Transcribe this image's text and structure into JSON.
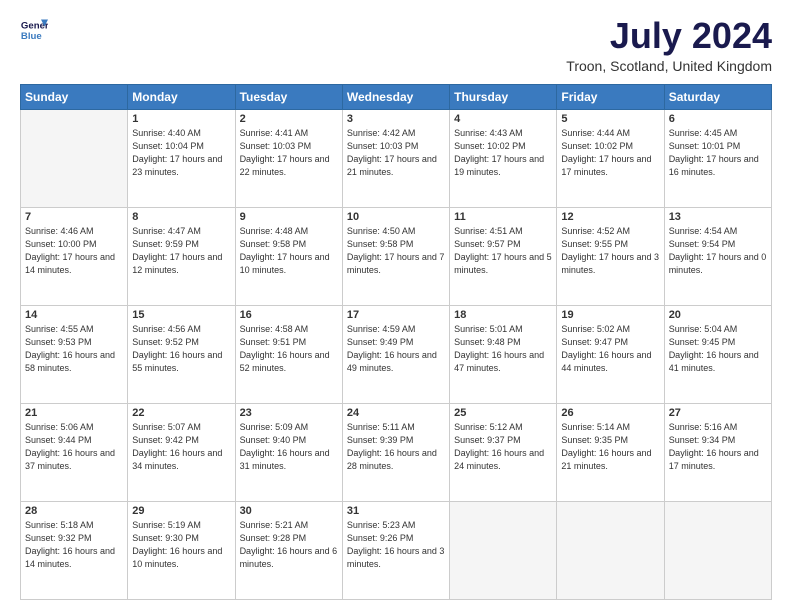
{
  "header": {
    "logo_line1": "General",
    "logo_line2": "Blue",
    "main_title": "July 2024",
    "subtitle": "Troon, Scotland, United Kingdom"
  },
  "columns": [
    "Sunday",
    "Monday",
    "Tuesday",
    "Wednesday",
    "Thursday",
    "Friday",
    "Saturday"
  ],
  "weeks": [
    [
      {
        "day": "",
        "text": ""
      },
      {
        "day": "1",
        "text": "Sunrise: 4:40 AM\nSunset: 10:04 PM\nDaylight: 17 hours\nand 23 minutes."
      },
      {
        "day": "2",
        "text": "Sunrise: 4:41 AM\nSunset: 10:03 PM\nDaylight: 17 hours\nand 22 minutes."
      },
      {
        "day": "3",
        "text": "Sunrise: 4:42 AM\nSunset: 10:03 PM\nDaylight: 17 hours\nand 21 minutes."
      },
      {
        "day": "4",
        "text": "Sunrise: 4:43 AM\nSunset: 10:02 PM\nDaylight: 17 hours\nand 19 minutes."
      },
      {
        "day": "5",
        "text": "Sunrise: 4:44 AM\nSunset: 10:02 PM\nDaylight: 17 hours\nand 17 minutes."
      },
      {
        "day": "6",
        "text": "Sunrise: 4:45 AM\nSunset: 10:01 PM\nDaylight: 17 hours\nand 16 minutes."
      }
    ],
    [
      {
        "day": "7",
        "text": "Sunrise: 4:46 AM\nSunset: 10:00 PM\nDaylight: 17 hours\nand 14 minutes."
      },
      {
        "day": "8",
        "text": "Sunrise: 4:47 AM\nSunset: 9:59 PM\nDaylight: 17 hours\nand 12 minutes."
      },
      {
        "day": "9",
        "text": "Sunrise: 4:48 AM\nSunset: 9:58 PM\nDaylight: 17 hours\nand 10 minutes."
      },
      {
        "day": "10",
        "text": "Sunrise: 4:50 AM\nSunset: 9:58 PM\nDaylight: 17 hours\nand 7 minutes."
      },
      {
        "day": "11",
        "text": "Sunrise: 4:51 AM\nSunset: 9:57 PM\nDaylight: 17 hours\nand 5 minutes."
      },
      {
        "day": "12",
        "text": "Sunrise: 4:52 AM\nSunset: 9:55 PM\nDaylight: 17 hours\nand 3 minutes."
      },
      {
        "day": "13",
        "text": "Sunrise: 4:54 AM\nSunset: 9:54 PM\nDaylight: 17 hours\nand 0 minutes."
      }
    ],
    [
      {
        "day": "14",
        "text": "Sunrise: 4:55 AM\nSunset: 9:53 PM\nDaylight: 16 hours\nand 58 minutes."
      },
      {
        "day": "15",
        "text": "Sunrise: 4:56 AM\nSunset: 9:52 PM\nDaylight: 16 hours\nand 55 minutes."
      },
      {
        "day": "16",
        "text": "Sunrise: 4:58 AM\nSunset: 9:51 PM\nDaylight: 16 hours\nand 52 minutes."
      },
      {
        "day": "17",
        "text": "Sunrise: 4:59 AM\nSunset: 9:49 PM\nDaylight: 16 hours\nand 49 minutes."
      },
      {
        "day": "18",
        "text": "Sunrise: 5:01 AM\nSunset: 9:48 PM\nDaylight: 16 hours\nand 47 minutes."
      },
      {
        "day": "19",
        "text": "Sunrise: 5:02 AM\nSunset: 9:47 PM\nDaylight: 16 hours\nand 44 minutes."
      },
      {
        "day": "20",
        "text": "Sunrise: 5:04 AM\nSunset: 9:45 PM\nDaylight: 16 hours\nand 41 minutes."
      }
    ],
    [
      {
        "day": "21",
        "text": "Sunrise: 5:06 AM\nSunset: 9:44 PM\nDaylight: 16 hours\nand 37 minutes."
      },
      {
        "day": "22",
        "text": "Sunrise: 5:07 AM\nSunset: 9:42 PM\nDaylight: 16 hours\nand 34 minutes."
      },
      {
        "day": "23",
        "text": "Sunrise: 5:09 AM\nSunset: 9:40 PM\nDaylight: 16 hours\nand 31 minutes."
      },
      {
        "day": "24",
        "text": "Sunrise: 5:11 AM\nSunset: 9:39 PM\nDaylight: 16 hours\nand 28 minutes."
      },
      {
        "day": "25",
        "text": "Sunrise: 5:12 AM\nSunset: 9:37 PM\nDaylight: 16 hours\nand 24 minutes."
      },
      {
        "day": "26",
        "text": "Sunrise: 5:14 AM\nSunset: 9:35 PM\nDaylight: 16 hours\nand 21 minutes."
      },
      {
        "day": "27",
        "text": "Sunrise: 5:16 AM\nSunset: 9:34 PM\nDaylight: 16 hours\nand 17 minutes."
      }
    ],
    [
      {
        "day": "28",
        "text": "Sunrise: 5:18 AM\nSunset: 9:32 PM\nDaylight: 16 hours\nand 14 minutes."
      },
      {
        "day": "29",
        "text": "Sunrise: 5:19 AM\nSunset: 9:30 PM\nDaylight: 16 hours\nand 10 minutes."
      },
      {
        "day": "30",
        "text": "Sunrise: 5:21 AM\nSunset: 9:28 PM\nDaylight: 16 hours\nand 6 minutes."
      },
      {
        "day": "31",
        "text": "Sunrise: 5:23 AM\nSunset: 9:26 PM\nDaylight: 16 hours\nand 3 minutes."
      },
      {
        "day": "",
        "text": ""
      },
      {
        "day": "",
        "text": ""
      },
      {
        "day": "",
        "text": ""
      }
    ]
  ]
}
